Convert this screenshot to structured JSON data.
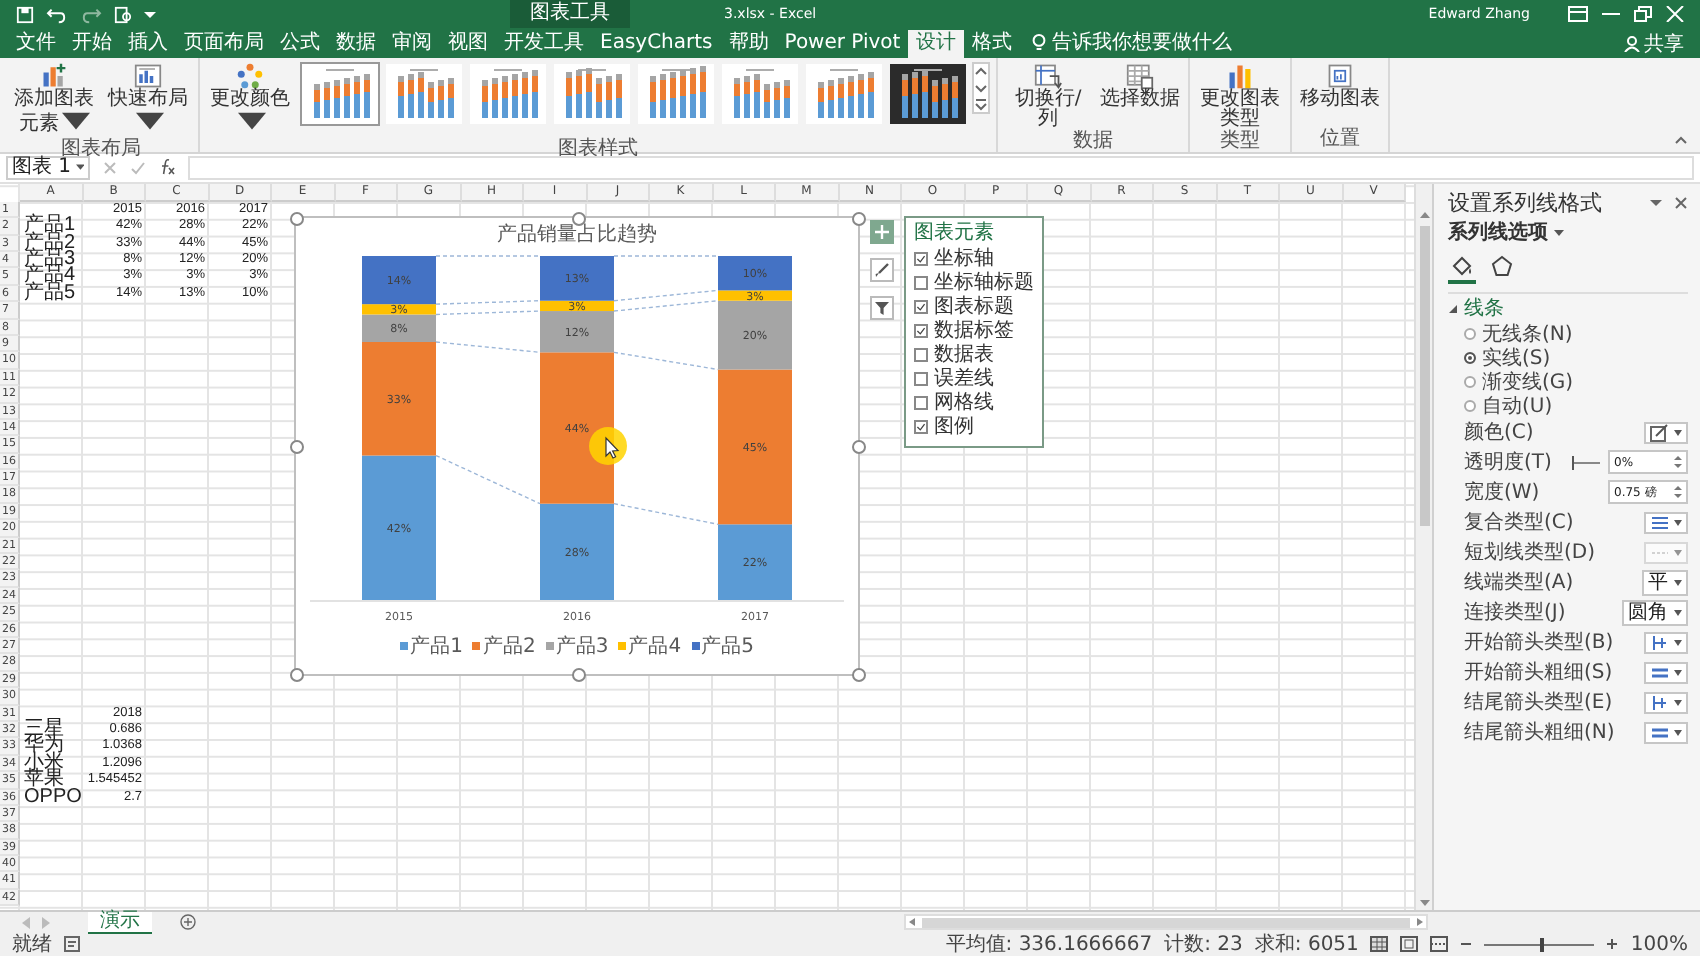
{
  "title_bar": {
    "context_group": "图表工具",
    "document": "3.xlsx  -  Excel",
    "user": "Edward Zhang"
  },
  "ribbon_tabs": [
    {
      "label": "文件",
      "selected": false
    },
    {
      "label": "开始",
      "selected": false
    },
    {
      "label": "插入",
      "selected": false
    },
    {
      "label": "页面布局",
      "selected": false
    },
    {
      "label": "公式",
      "selected": false
    },
    {
      "label": "数据",
      "selected": false
    },
    {
      "label": "审阅",
      "selected": false
    },
    {
      "label": "视图",
      "selected": false
    },
    {
      "label": "开发工具",
      "selected": false
    },
    {
      "label": "EasyCharts",
      "selected": false
    },
    {
      "label": "帮助",
      "selected": false
    },
    {
      "label": "Power Pivot",
      "selected": false
    },
    {
      "label": "设计",
      "selected": true
    },
    {
      "label": "格式",
      "selected": false
    }
  ],
  "tell_me": "告诉我你想要做什么",
  "share": "共享",
  "ribbon_groups": [
    {
      "label": "图表布局",
      "buttons": [
        {
          "label": "添加图表元素",
          "menu": true
        },
        {
          "label": "快速布局",
          "menu": true
        }
      ]
    },
    {
      "label": "图表样式",
      "buttons": [
        {
          "label": "更改颜色",
          "menu": true
        }
      ],
      "chart_styles": [
        {
          "selected": true,
          "dark": false
        },
        {
          "selected": false,
          "dark": false
        },
        {
          "selected": false,
          "dark": false
        },
        {
          "selected": false,
          "dark": false
        },
        {
          "selected": false,
          "dark": false
        },
        {
          "selected": false,
          "dark": false
        },
        {
          "selected": false,
          "dark": false
        },
        {
          "selected": false,
          "dark": true
        }
      ]
    },
    {
      "label": "数据",
      "buttons": [
        {
          "label": "切换行/列",
          "menu": false
        },
        {
          "label": "选择数据",
          "menu": false
        }
      ]
    },
    {
      "label": "类型",
      "buttons": [
        {
          "label": "更改图表类型",
          "menu": false
        }
      ]
    },
    {
      "label": "位置",
      "buttons": [
        {
          "label": "移动图表",
          "menu": false
        }
      ]
    }
  ],
  "formula_bar": {
    "name_box": "图表 1"
  },
  "sheet": {
    "columns": [
      "A",
      "B",
      "C",
      "D",
      "E",
      "F",
      "G",
      "H",
      "I",
      "J",
      "K",
      "L",
      "M",
      "N",
      "O",
      "P",
      "Q",
      "R",
      "S",
      "T",
      "U",
      "V"
    ],
    "rows": [
      {
        "number": "1",
        "cells": {
          "B": "2015",
          "C": "2016",
          "D": "2017"
        }
      },
      {
        "number": "2",
        "cells": {
          "A": "产品1",
          "B": "42%",
          "C": "28%",
          "D": "22%"
        }
      },
      {
        "number": "3",
        "cells": {
          "A": "产品2",
          "B": "33%",
          "C": "44%",
          "D": "45%"
        }
      },
      {
        "number": "4",
        "cells": {
          "A": "产品3",
          "B": "8%",
          "C": "12%",
          "D": "20%"
        }
      },
      {
        "number": "5",
        "cells": {
          "A": "产品4",
          "B": "3%",
          "C": "3%",
          "D": "3%"
        }
      },
      {
        "number": "6",
        "cells": {
          "A": "产品5",
          "B": "14%",
          "C": "13%",
          "D": "10%"
        }
      },
      {
        "number": "7"
      },
      {
        "number": "8"
      },
      {
        "number": "9"
      },
      {
        "number": "10"
      },
      {
        "number": "11"
      },
      {
        "number": "12"
      },
      {
        "number": "13"
      },
      {
        "number": "14"
      },
      {
        "number": "15"
      },
      {
        "number": "16"
      },
      {
        "number": "17"
      },
      {
        "number": "18"
      },
      {
        "number": "19"
      },
      {
        "number": "20"
      },
      {
        "number": "21"
      },
      {
        "number": "22"
      },
      {
        "number": "23"
      },
      {
        "number": "24"
      },
      {
        "number": "25"
      },
      {
        "number": "26"
      },
      {
        "number": "27"
      },
      {
        "number": "28"
      },
      {
        "number": "29"
      },
      {
        "number": "30"
      },
      {
        "number": "31",
        "cells": {
          "B": "2018"
        }
      },
      {
        "number": "32",
        "cells": {
          "A": "三星",
          "B": "0.686"
        }
      },
      {
        "number": "33",
        "cells": {
          "A": "华为",
          "B": "1.0368"
        }
      },
      {
        "number": "34",
        "cells": {
          "A": "小米",
          "B": "1.2096"
        }
      },
      {
        "number": "35",
        "cells": {
          "A": "苹果",
          "B": "1.545452"
        }
      },
      {
        "number": "36",
        "cells": {
          "A": "OPPO",
          "B": "2.7"
        }
      },
      {
        "number": "37"
      },
      {
        "number": "38"
      },
      {
        "number": "39"
      },
      {
        "number": "40"
      },
      {
        "number": "41"
      },
      {
        "number": "42"
      }
    ]
  },
  "chart": {
    "title": "产品销量占比趋势",
    "chart_data": {
      "type": "bar",
      "stacked": true,
      "orientation": "vertical",
      "categories": [
        "2015",
        "2016",
        "2017"
      ],
      "series": [
        {
          "name": "产品1",
          "color": "#5b9bd5",
          "values": [
            42,
            28,
            22
          ],
          "value_labels": [
            "42%",
            "28%",
            "22%"
          ]
        },
        {
          "name": "产品2",
          "color": "#ed7d31",
          "values": [
            33,
            44,
            45
          ],
          "value_labels": [
            "33%",
            "44%",
            "45%"
          ]
        },
        {
          "name": "产品3",
          "color": "#a5a5a5",
          "values": [
            8,
            12,
            20
          ],
          "value_labels": [
            "8%",
            "12%",
            "20%"
          ]
        },
        {
          "name": "产品4",
          "color": "#ffc000",
          "values": [
            3,
            3,
            3
          ],
          "value_labels": [
            "3%",
            "3%",
            "3%"
          ]
        },
        {
          "name": "产品5",
          "color": "#4472c4",
          "values": [
            14,
            13,
            10
          ],
          "value_labels": [
            "14%",
            "13%",
            "10%"
          ]
        }
      ]
    },
    "tools": [
      {
        "kind": "add",
        "selected": true
      },
      {
        "kind": "style",
        "selected": false
      },
      {
        "kind": "filter",
        "selected": false
      }
    ]
  },
  "chart_elements": {
    "title": "图表元素",
    "items": [
      {
        "label": "坐标轴",
        "checked": true
      },
      {
        "label": "坐标轴标题",
        "checked": false
      },
      {
        "label": "图表标题",
        "checked": true
      },
      {
        "label": "数据标签",
        "checked": true
      },
      {
        "label": "数据表",
        "checked": false
      },
      {
        "label": "误差线",
        "checked": false
      },
      {
        "label": "网格线",
        "checked": false
      },
      {
        "label": "图例",
        "checked": true
      }
    ]
  },
  "format_pane": {
    "title": "设置系列线格式",
    "options_menu": "系列线选项",
    "tabs": [
      {
        "kind": "fill",
        "selected": true
      },
      {
        "kind": "shape",
        "selected": false
      }
    ],
    "section": {
      "label": "线条",
      "expanded": true
    },
    "line_options": [
      {
        "label": "无线条(N)",
        "selected": false
      },
      {
        "label": "实线(S)",
        "selected": true
      },
      {
        "label": "渐变线(G)",
        "selected": false
      },
      {
        "label": "自动(U)",
        "selected": false
      }
    ],
    "properties": [
      {
        "label": "颜色(C)",
        "kind": "color"
      },
      {
        "label": "透明度(T)",
        "kind": "slider",
        "level": 0,
        "value": "0%"
      },
      {
        "label": "宽度(W)",
        "kind": "spin",
        "value": "0.75 磅"
      },
      {
        "label": "复合类型(C)",
        "kind": "compound"
      },
      {
        "label": "短划线类型(D)",
        "kind": "dash"
      },
      {
        "label": "线端类型(A)",
        "kind": "select",
        "value": "平"
      },
      {
        "label": "连接类型(J)",
        "kind": "select",
        "value": "圆角"
      },
      {
        "label": "开始箭头类型(B)",
        "kind": "arrow"
      },
      {
        "label": "开始箭头粗细(S)",
        "kind": "size"
      },
      {
        "label": "结尾箭头类型(E)",
        "kind": "arrow"
      },
      {
        "label": "结尾箭头粗细(N)",
        "kind": "size"
      }
    ]
  },
  "sheet_tabs": [
    {
      "label": "演示",
      "selected": true
    }
  ],
  "status_bar": {
    "state": "就绪",
    "average": "平均值: 336.1666667",
    "count": "计数: 23",
    "sum": "求和: 6051",
    "zoom": "100%",
    "zoom_slider": {
      "level": 0.5
    }
  }
}
